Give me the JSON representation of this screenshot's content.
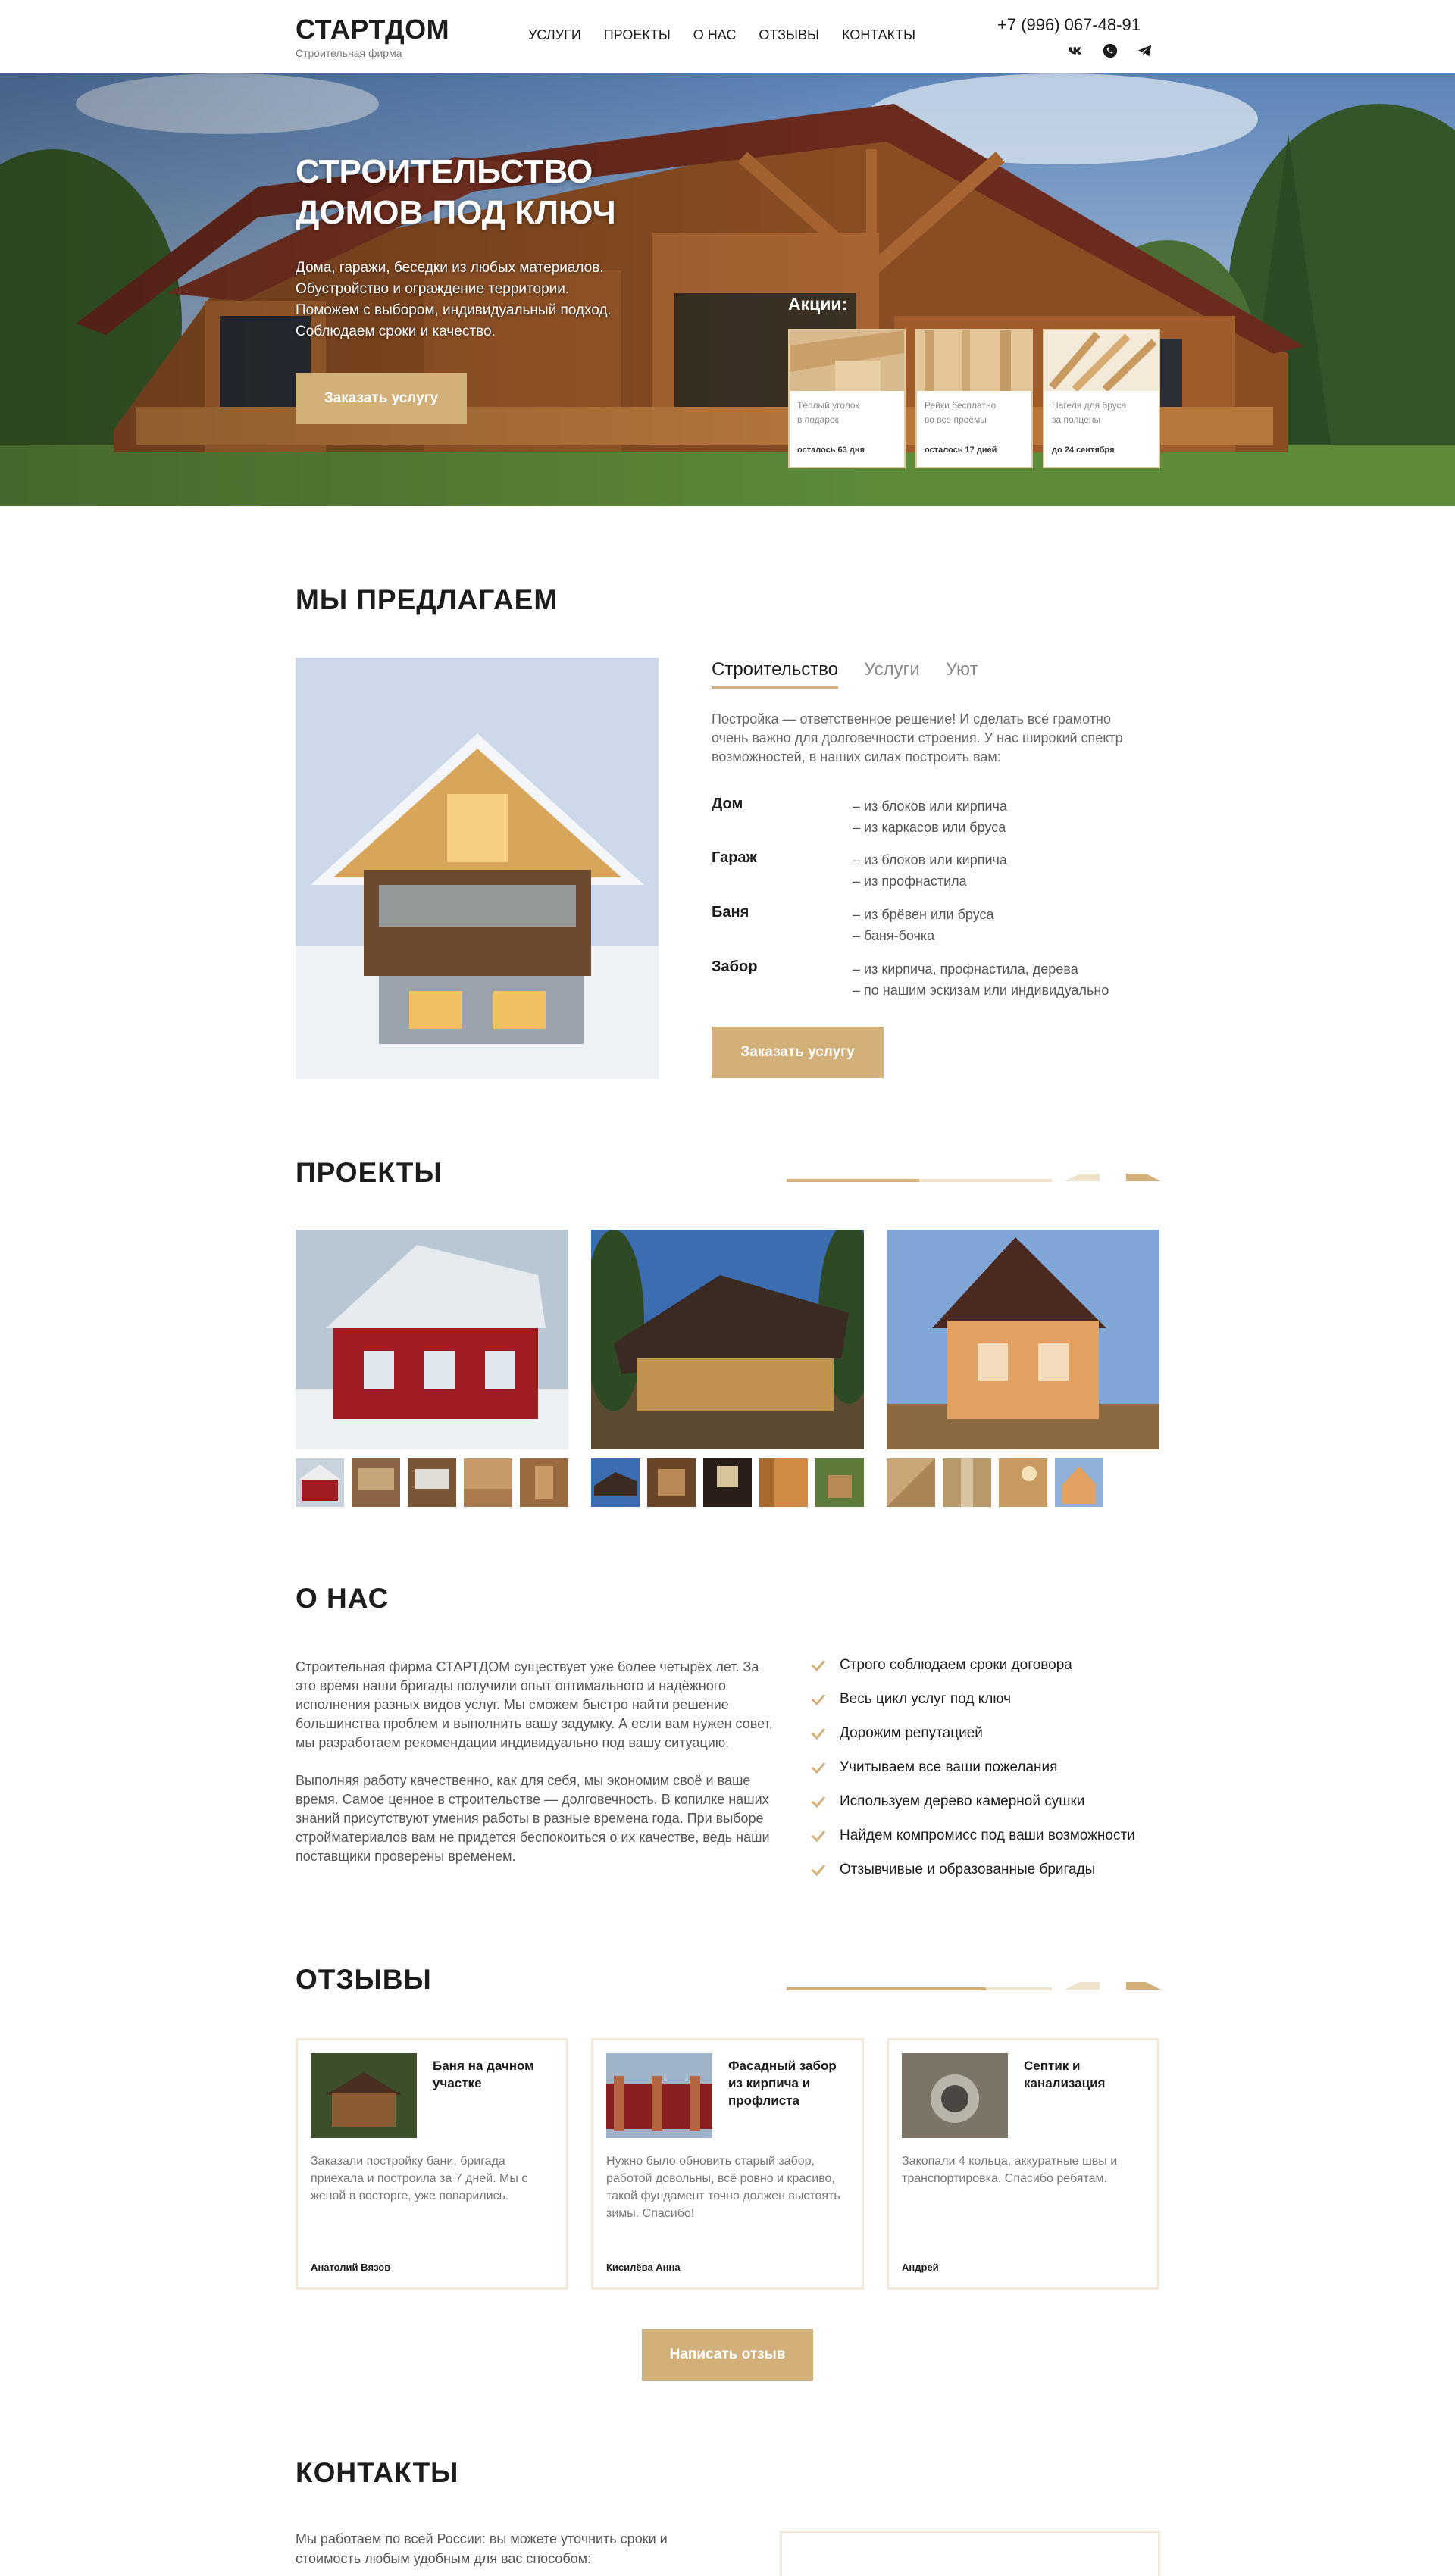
{
  "header": {
    "logo": "СТАРТДОМ",
    "logo_sub": "Строительная фирма",
    "nav": [
      "УСЛУГИ",
      "ПРОЕКТЫ",
      "О НАС",
      "ОТЗЫВЫ",
      "КОНТАКТЫ"
    ],
    "phone": "+7 (996) 067-48-91",
    "socials": [
      "vk-icon",
      "whatsapp-icon",
      "telegram-icon"
    ]
  },
  "hero": {
    "title_line1": "СТРОИТЕЛЬСТВО",
    "title_line2": "ДОМОВ ПОД КЛЮЧ",
    "text_lines": [
      "Дома, гаражи, беседки из любых материалов.",
      "Обустройство и ограждение территории.",
      "Поможем с выбором, индивидуальный подход.",
      "Соблюдаем сроки и качество."
    ],
    "button": "Заказать услугу",
    "promo_title": "Акции:",
    "promos": [
      {
        "line1": "Тёплый уголок",
        "line2": "в подарок",
        "date": "осталось 63 дня"
      },
      {
        "line1": "Рейки бесплатно",
        "line2": "во все проёмы",
        "date": "осталось 17 дней"
      },
      {
        "line1": "Нагеля для бруса",
        "line2": "за полцены",
        "date": "до 24 сентября"
      }
    ]
  },
  "offer": {
    "title": "МЫ ПРЕДЛАГАЕМ",
    "tabs": [
      "Строительство",
      "Услуги",
      "Уют"
    ],
    "active_tab": "Строительство",
    "intro": "Постройка — ответственное решение! И сделать всё грамотно очень важно для долговечности строения. У нас широкий спектр возможностей, в наших силах построить вам:",
    "rows": [
      {
        "name": "Дом",
        "line1": "– из блоков или кирпича",
        "line2": "– из каркасов или бруса"
      },
      {
        "name": "Гараж",
        "line1": "– из блоков или кирпича",
        "line2": "– из профнастила"
      },
      {
        "name": "Баня",
        "line1": "– из брёвен или бруса",
        "line2": "– баня-бочка"
      },
      {
        "name": "Забор",
        "line1": "– из кирпича, профнастила, дерева",
        "line2": "– по нашим эскизам или индивидуально"
      }
    ],
    "button": "Заказать услугу"
  },
  "projects": {
    "title": "ПРОЕКТЫ",
    "slider_progress": 0.5
  },
  "about": {
    "title": "О НАС",
    "p1": "Строительная фирма СТАРТДОМ существует уже более четырёх лет. За это время наши бригады получили опыт оптимального и надёжного исполнения разных видов услуг. Мы сможем быстро найти решение большинства проблем и выполнить вашу задумку. А если вам нужен совет, мы разработаем рекомендации индивидуально под вашу ситуацию.",
    "p2": "Выполняя работу качественно, как для себя, мы экономим своё и ваше время. Самое ценное в строительстве — долговечность. В копилке наших знаний присутствуют умения работы в разные времена года. При выборе стройматериалов вам не придется беспокоиться о их качестве, ведь наши поставщики проверены временем.",
    "checks": [
      "Строго соблюдаем сроки договора",
      "Весь цикл услуг под ключ",
      "Дорожим репутацией",
      "Учитываем все ваши пожелания",
      "Используем дерево камерной сушки",
      "Найдем компромисс под ваши возможности",
      "Отзывчивые и образованные бригады"
    ]
  },
  "reviews": {
    "title": "ОТЗЫВЫ",
    "slider_progress": 0.75,
    "items": [
      {
        "title": "Баня на дачном участке",
        "text": "Заказали постройку бани, бригада приехала и построила за 7 дней. Мы с женой в восторге, уже попарились.",
        "author": "Анатолий Вязов"
      },
      {
        "title": "Фасадный забор из кирпича и профлиста",
        "text": "Нужно было обновить старый забор, работой довольны, всё ровно и красиво, такой фундамент точно должен выстоять зимы. Спасибо!",
        "author": "Кисилёва Анна"
      },
      {
        "title": "Септик и канализация",
        "text": "Закопали 4 кольца, аккуратные швы и транспортировка. Спасибо ребятам.",
        "author": "Андрей"
      }
    ],
    "button": "Написать отзыв"
  },
  "contacts": {
    "title": "КОНТАКТЫ",
    "text": "Мы работаем по всей России: вы можете уточнить сроки и стоимость любым удобным для вас способом:"
  }
}
